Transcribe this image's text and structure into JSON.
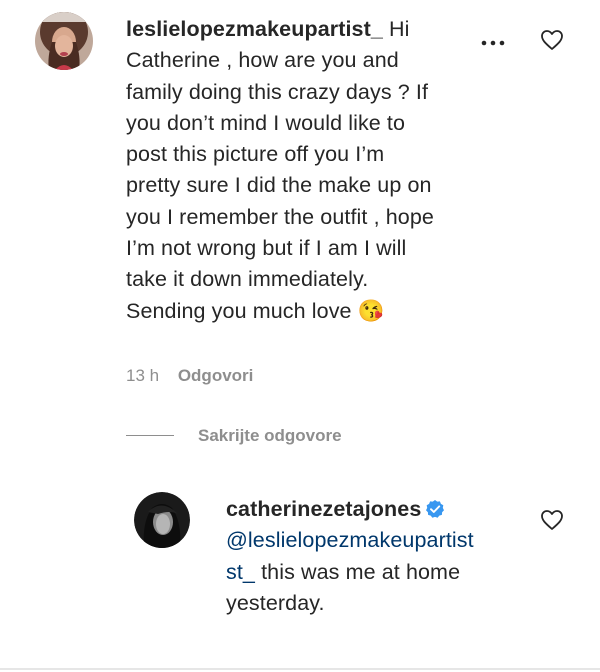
{
  "comment": {
    "username": "leslielopezmakeupartist_",
    "lines": [
      "Hi",
      "Catherine , how are you and",
      "family doing this crazy days ? If",
      "you don’t mind I would like to",
      "post this picture off you I’m",
      "pretty sure I did the make up on",
      "you I remember the outfit , hope",
      "I’m not wrong but if I am I will",
      "take it down immediately.",
      "Sending you much love"
    ],
    "emoji": "😘",
    "time": "13 h",
    "reply_label": "Odgovori",
    "more_icon": "more-horizontal-icon",
    "like_icon": "heart-outline-icon"
  },
  "replies_toggle": {
    "label": "Sakrijte odgovore"
  },
  "reply": {
    "username": "catherinezetajones",
    "verified": true,
    "mention_lines": [
      "@leslielopezmakeupartist",
      "st_"
    ],
    "lines": [
      "this was me at home",
      "yesterday."
    ],
    "like_icon": "heart-outline-icon"
  },
  "colors": {
    "text": "#262626",
    "secondary": "#8e8e8e",
    "mention": "#00376b",
    "verified": "#3897f0"
  }
}
